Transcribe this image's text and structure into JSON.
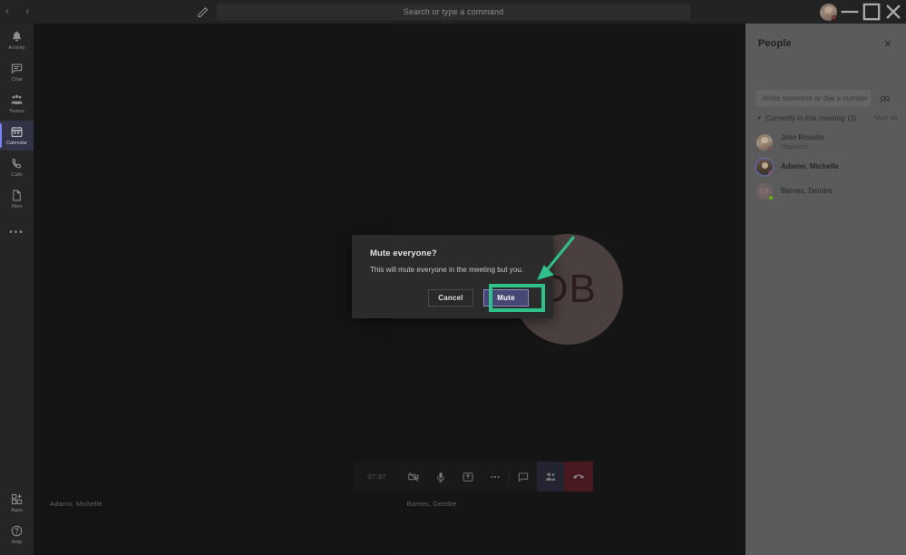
{
  "titlebar": {
    "back_label": "‹",
    "forward_label": "›",
    "compose_icon": "compose-icon",
    "search_placeholder": "Search or type a command",
    "avatar_name": "user-avatar",
    "minimize_label": "–",
    "maximize_label": "☐",
    "close_label": "✕"
  },
  "rail": {
    "items": [
      {
        "label": "Activity",
        "icon": "bell-icon",
        "selected": false
      },
      {
        "label": "Chat",
        "icon": "chat-icon",
        "selected": false
      },
      {
        "label": "Teams",
        "icon": "teams-icon",
        "selected": false
      },
      {
        "label": "Calendar",
        "icon": "calendar-icon",
        "selected": true
      },
      {
        "label": "Calls",
        "icon": "phone-icon",
        "selected": false
      },
      {
        "label": "Files",
        "icon": "files-icon",
        "selected": false
      }
    ],
    "more_label": "•••",
    "bottom": [
      {
        "label": "Apps",
        "icon": "apps-icon"
      },
      {
        "label": "Help",
        "icon": "help-icon"
      }
    ]
  },
  "stage": {
    "tiles": [
      {
        "name": "Adamo, Michelle",
        "initials": null
      },
      {
        "name": "Barnes, Deirdre",
        "initials": "DB"
      }
    ]
  },
  "controls": {
    "timer": "07:37",
    "buttons": [
      {
        "name": "camera-off-icon",
        "label": "Camera"
      },
      {
        "name": "microphone-icon",
        "label": "Mic"
      },
      {
        "name": "share-screen-icon",
        "label": "Share"
      },
      {
        "name": "more-options-icon",
        "label": "More actions"
      },
      {
        "name": "chat-bubble-icon",
        "label": "Show conversation"
      },
      {
        "name": "people-icon",
        "label": "Show participants"
      },
      {
        "name": "hangup-icon",
        "label": "Hang up"
      }
    ]
  },
  "modal": {
    "title": "Mute everyone?",
    "body": "This will mute everyone in the meeting but you.",
    "cancel_label": "Cancel",
    "mute_label": "Mute",
    "highlight_color": "#30c08a",
    "mute_button_color": "#464775"
  },
  "people_panel": {
    "title": "People",
    "close_label": "✕",
    "invite_placeholder": "Invite someone or dial a number",
    "invite_icon": "share-contact-icon",
    "section_label": "Currently in this meeting",
    "section_count": "(3)",
    "mute_all_label": "Mute all",
    "participants": [
      {
        "name": "Jose Rosario",
        "role": "Organizer",
        "status": "busy",
        "avatar": "photo",
        "initials": null,
        "bold": false
      },
      {
        "name": "Adamo, Michelle",
        "role": null,
        "status": "busy",
        "avatar": "photo-ringed",
        "initials": null,
        "bold": true
      },
      {
        "name": "Barnes, Deirdre",
        "role": null,
        "status": "available",
        "avatar": "initials",
        "initials": "DB",
        "bold": false
      }
    ]
  }
}
